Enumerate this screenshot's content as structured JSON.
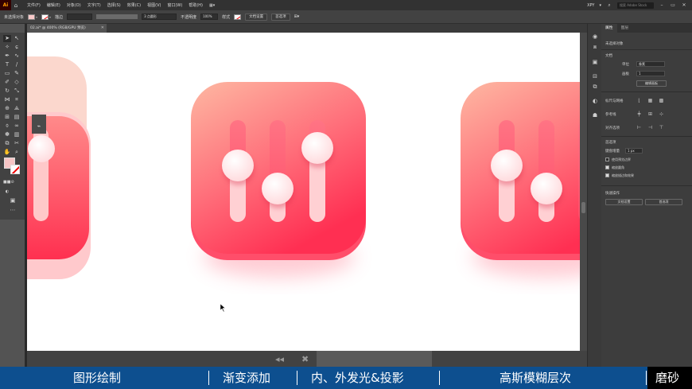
{
  "app": {
    "logo": "Ai",
    "menus": [
      "文件(F)",
      "编辑(E)",
      "对象(O)",
      "文字(T)",
      "选择(S)",
      "效果(C)",
      "视图(V)",
      "窗口(W)",
      "帮助(H)"
    ],
    "workspace": "XPY",
    "search_placeholder": "搜索 Adobe Stock"
  },
  "control_bar": {
    "selection_label": "未选择对象",
    "stroke_label": "描边",
    "stroke_value": "",
    "brush_label": "3 点圆形",
    "opacity_label": "不透明度",
    "opacity_value": "100%",
    "style_label": "样式",
    "doc_setup_button": "文档设置",
    "prefs_button": "首选项"
  },
  "document": {
    "tab_title": "02.ai* @ 400% (RGB/GPU 预览)"
  },
  "properties_panel": {
    "tabs": [
      "属性",
      "图层"
    ],
    "section_title": "未选择对象",
    "doc_section": "文档",
    "unit_label": "单位",
    "unit_value": "像素",
    "artboard_label": "画板",
    "artboard_value": "1",
    "edit_artboard_button": "编辑画板",
    "rulers_label": "标尺与网格",
    "guides_label": "参考线",
    "align_label": "对齐选项",
    "prefs_section": "首选项",
    "keyboard_increment_label": "键盘增量",
    "keyboard_increment_value": "1 px",
    "checkbox_corners": "使用预览边界",
    "checkbox_scale_strokes": "缩放圆角",
    "checkbox_scale_effects": "缩放描边和效果",
    "quick_actions_label": "快速操作",
    "doc_setup_button": "文档设置",
    "prefs_button": "首选项"
  },
  "banner": {
    "segments": [
      "图形绘制",
      "渐变添加",
      "内、外发光&投影",
      "高斯模糊层次",
      "磨砂"
    ]
  },
  "colors": {
    "gradient_top": "#fdb8a2",
    "gradient_mid": "#ff6e7a",
    "gradient_bottom": "#ff2f52",
    "banner_bg": "#0d4f8f"
  }
}
